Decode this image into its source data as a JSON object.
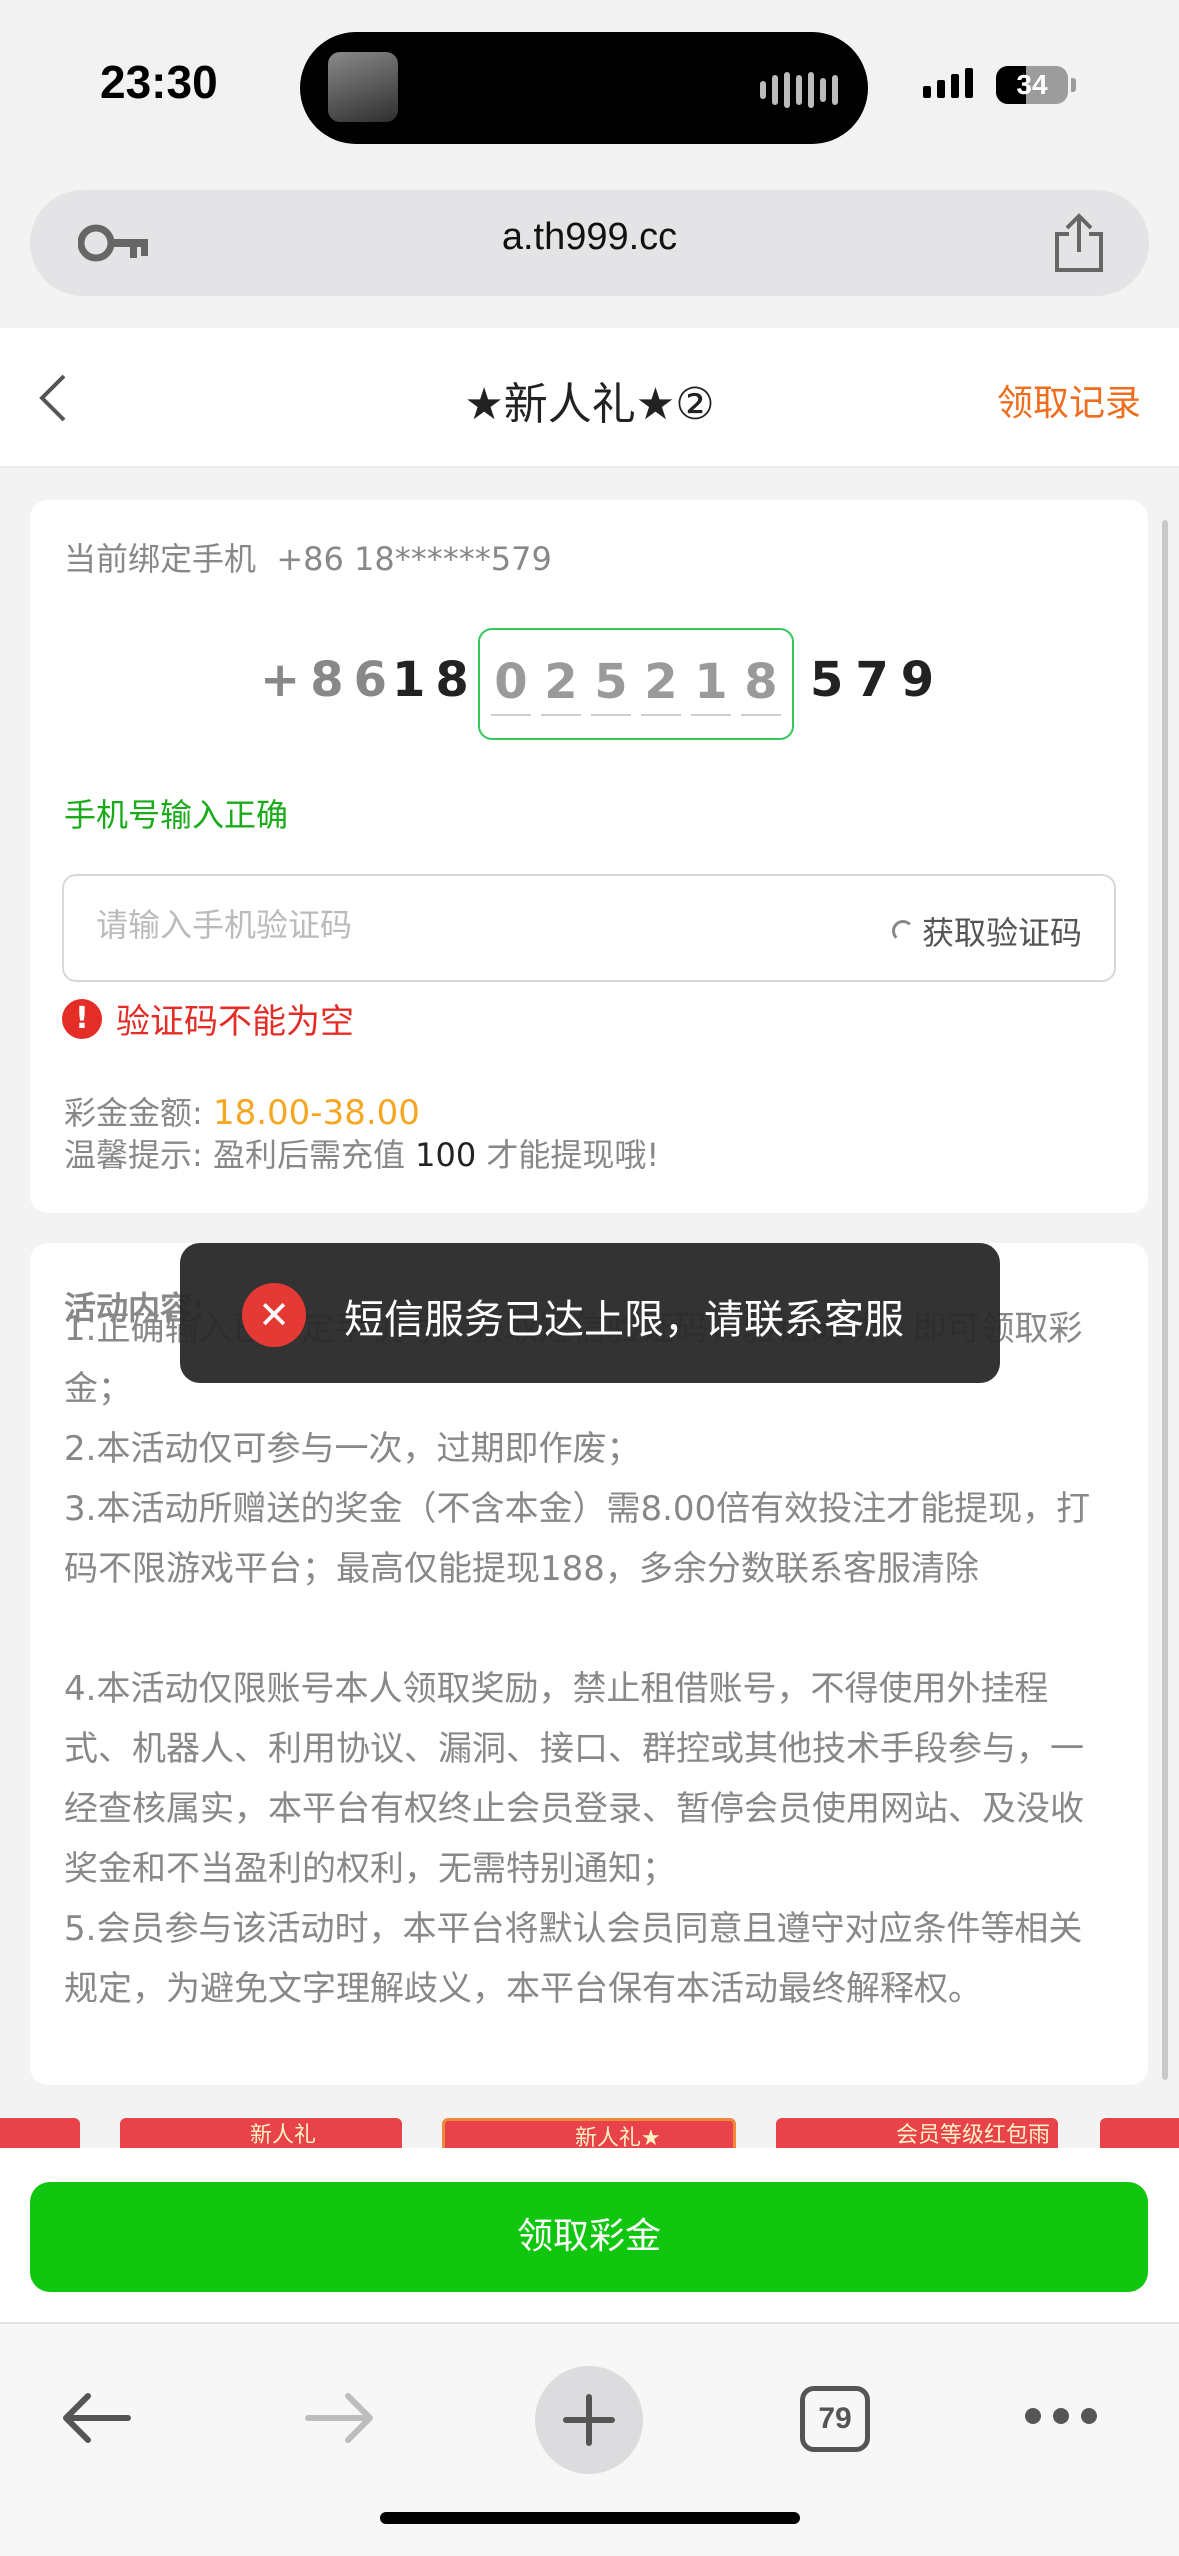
{
  "status_bar": {
    "time": "23:30",
    "battery": "34"
  },
  "browser": {
    "url": "a.th999.cc",
    "tab_count": "79"
  },
  "header": {
    "title": "★新人礼★②",
    "records_label": "领取记录"
  },
  "form": {
    "bound_phone_label": "当前绑定手机",
    "bound_phone_value": "+86 18******579",
    "phone_prefix": "+86",
    "phone_start": "18",
    "phone_digits": [
      "0",
      "2",
      "5",
      "2",
      "1",
      "8"
    ],
    "phone_end": "579",
    "phone_ok": "手机号输入正确",
    "code_placeholder": "请输入手机验证码",
    "get_code_label": "获取验证码",
    "error_text": "验证码不能为空",
    "bonus_label": "彩金金额:",
    "bonus_value": "18.00-38.00",
    "tip_prefix": "温馨提示: 盈利后需充值",
    "tip_amount": "100",
    "tip_suffix": "才能提现哦!"
  },
  "activity": {
    "title": "活动内容:",
    "items": [
      "1.正确输入已绑定手机号，获取短信验证码，验证成功，即可领取彩金；",
      "2.本活动仅可参与一次，过期即作废；",
      "3.本活动所赠送的奖金（不含本金）需8.00倍有效投注才能提现，打码不限游戏平台；最高仅能提现188，多余分数联系客服清除",
      "4.本活动仅限账号本人领取奖励，禁止租借账号，不得使用外挂程式、机器人、利用协议、漏洞、接口、群控或其他技术手段参与，一经查核属实，本平台有权终止会员登录、暂停会员使用网站、及没收奖金和不当盈利的权利，无需特别通知；",
      "5.会员参与该活动时，本平台将默认会员同意且遵守对应条件等相关规定，为避免文字理解歧义，本平台保有本活动最终解释权。"
    ]
  },
  "toast": {
    "text": "短信服务已达上限，请联系客服"
  },
  "banners": [
    "新人礼",
    "新人礼★",
    "会员等级红包雨"
  ],
  "claim_button": "领取彩金",
  "colors": {
    "accent_green": "#11c60f",
    "error_red": "#e52d27",
    "orange": "#ee6d1e",
    "bonus": "#f5a623"
  }
}
